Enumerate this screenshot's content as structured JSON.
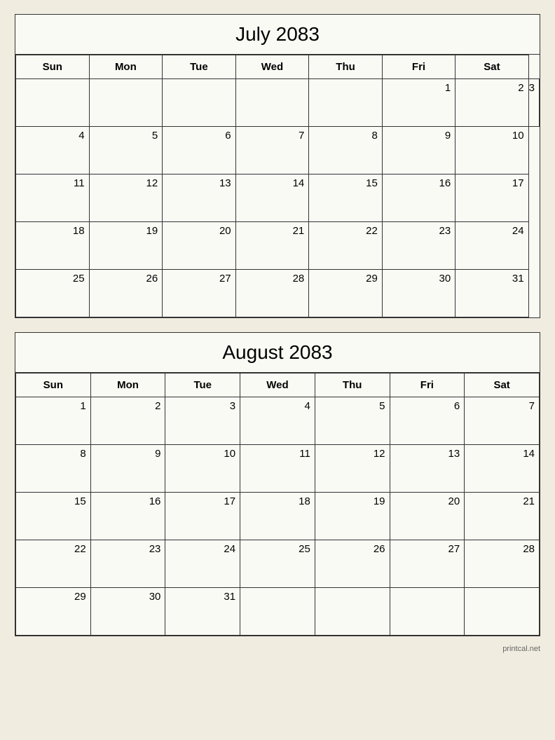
{
  "july": {
    "title": "July 2083",
    "headers": [
      "Sun",
      "Mon",
      "Tue",
      "Wed",
      "Thu",
      "Fri",
      "Sat"
    ],
    "weeks": [
      [
        null,
        null,
        null,
        null,
        null,
        1,
        2,
        3
      ],
      [
        4,
        5,
        6,
        7,
        8,
        9,
        10
      ],
      [
        11,
        12,
        13,
        14,
        15,
        16,
        17
      ],
      [
        18,
        19,
        20,
        21,
        22,
        23,
        24
      ],
      [
        25,
        26,
        27,
        28,
        29,
        30,
        31
      ]
    ]
  },
  "august": {
    "title": "August 2083",
    "headers": [
      "Sun",
      "Mon",
      "Tue",
      "Wed",
      "Thu",
      "Fri",
      "Sat"
    ],
    "weeks": [
      [
        1,
        2,
        3,
        4,
        5,
        6,
        7
      ],
      [
        8,
        9,
        10,
        11,
        12,
        13,
        14
      ],
      [
        15,
        16,
        17,
        18,
        19,
        20,
        21
      ],
      [
        22,
        23,
        24,
        25,
        26,
        27,
        28
      ],
      [
        29,
        30,
        31,
        null,
        null,
        null,
        null
      ]
    ]
  },
  "watermark": "printcal.net"
}
